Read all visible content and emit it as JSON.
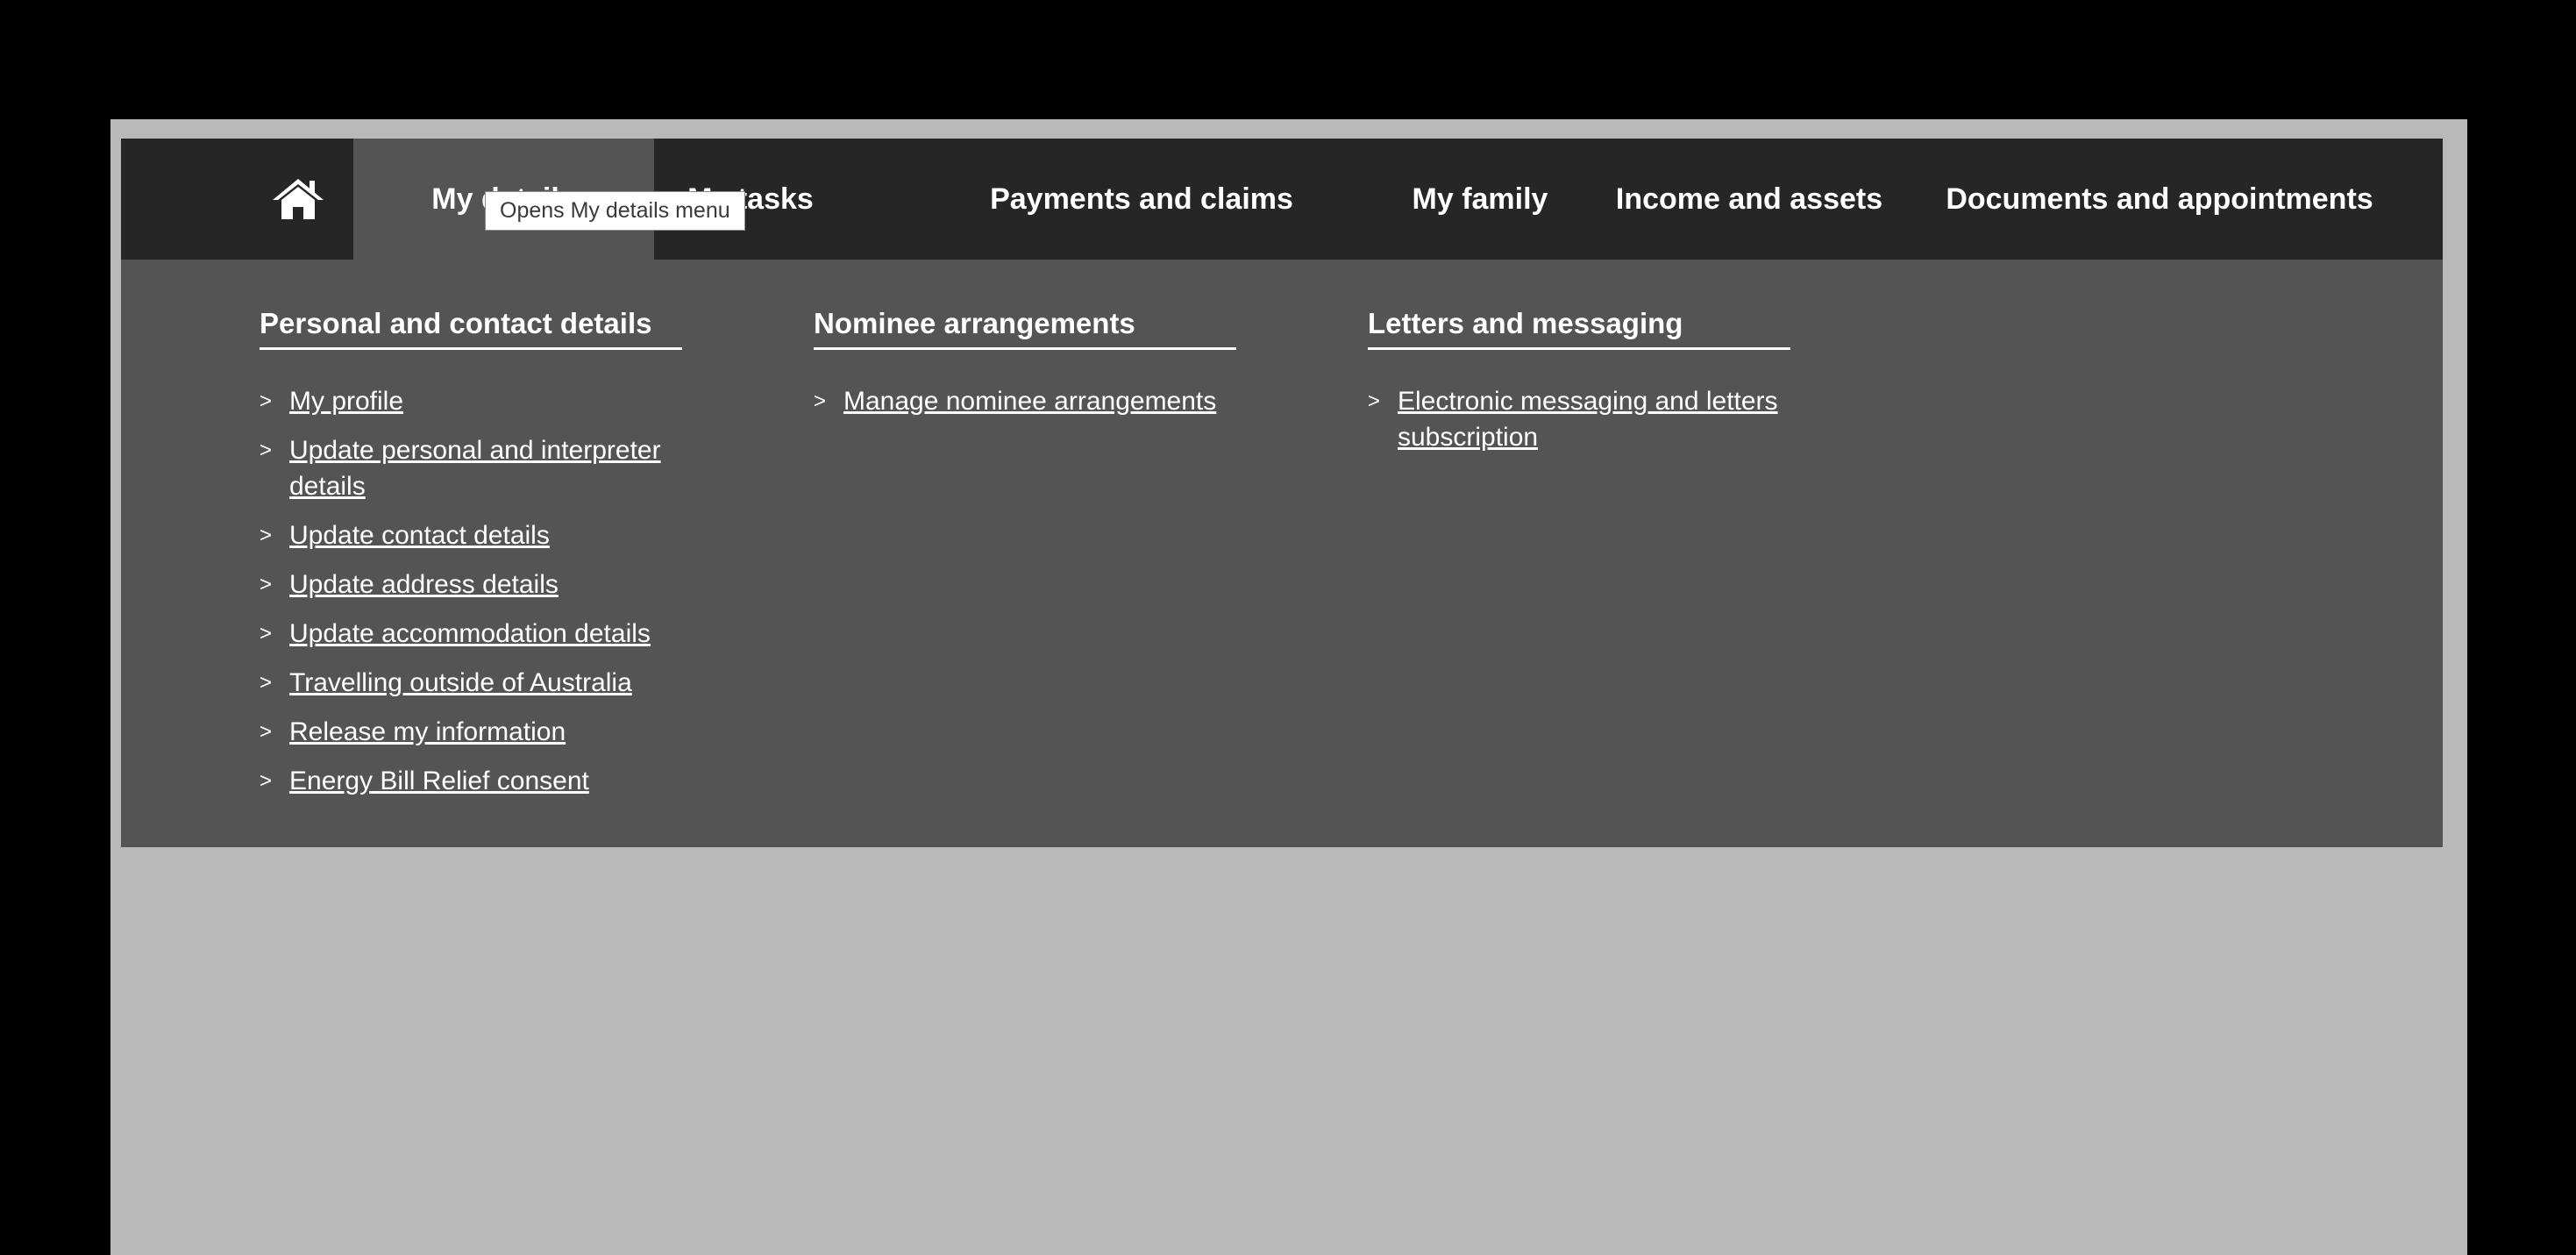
{
  "tooltip": "Opens My details menu",
  "nav": {
    "home_icon": "home-icon",
    "items": [
      {
        "label": "My details"
      },
      {
        "label": "My tasks"
      },
      {
        "label": "Payments and claims"
      },
      {
        "label": "My family"
      },
      {
        "label": "Income and assets"
      },
      {
        "label": "Documents and appointments"
      }
    ]
  },
  "menu": {
    "arrow": ">",
    "columns": [
      {
        "heading": "Personal and contact details",
        "links": [
          "My profile",
          "Update personal and interpreter details",
          "Update contact details",
          "Update address details",
          "Update accommodation details",
          "Travelling outside of Australia",
          "Release my information",
          "Energy Bill Relief consent"
        ]
      },
      {
        "heading": "Nominee arrangements",
        "links": [
          "Manage nominee arrangements"
        ]
      },
      {
        "heading": "Letters and messaging",
        "links": [
          "Electronic messaging and letters subscription"
        ]
      }
    ]
  }
}
